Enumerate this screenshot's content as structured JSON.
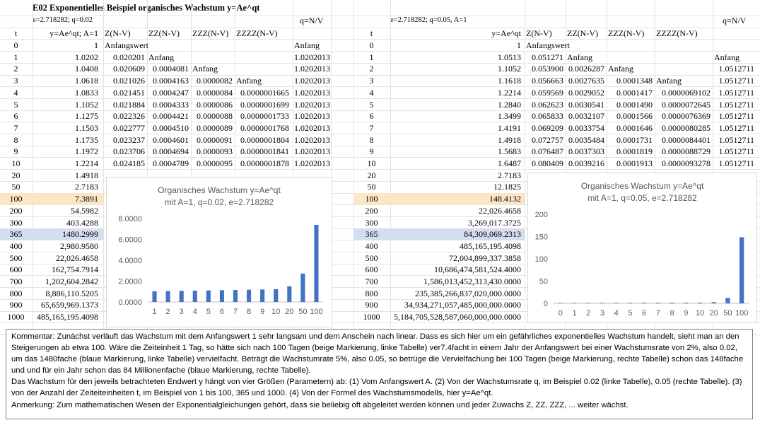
{
  "sheet": {
    "title": "E02 Exponentielles Beispiel organisches Wachstum y=Ae^qt",
    "left": {
      "params": "e=2.718282; q=0.02",
      "qnv": "q=N/V",
      "headers": [
        "t",
        "y=Ae^qt; A=1",
        "Z(N-V)",
        "ZZ(N-V)",
        "ZZZ(N-V)",
        "ZZZZ(N-V)",
        ""
      ],
      "rows": [
        [
          "0",
          "1",
          "Anfangswert",
          "",
          "",
          "",
          "Anfang"
        ],
        [
          "1",
          "1.0202",
          "0.020201",
          "Anfang",
          "",
          "",
          "1.0202013"
        ],
        [
          "2",
          "1.0408",
          "0.020609",
          "0.0004081",
          "Anfang",
          "",
          "1.0202013"
        ],
        [
          "3",
          "1.0618",
          "0.021026",
          "0.0004163",
          "0.0000082",
          "Anfang",
          "1.0202013"
        ],
        [
          "4",
          "1.0833",
          "0.021451",
          "0.0004247",
          "0.0000084",
          "0.0000001665",
          "1.0202013"
        ],
        [
          "5",
          "1.1052",
          "0.021884",
          "0.0004333",
          "0.0000086",
          "0.0000001699",
          "1.0202013"
        ],
        [
          "6",
          "1.1275",
          "0.022326",
          "0.0004421",
          "0.0000088",
          "0.0000001733",
          "1.0202013"
        ],
        [
          "7",
          "1.1503",
          "0.022777",
          "0.0004510",
          "0.0000089",
          "0.0000001768",
          "1.0202013"
        ],
        [
          "8",
          "1.1735",
          "0.023237",
          "0.0004601",
          "0.0000091",
          "0.0000001804",
          "1.0202013"
        ],
        [
          "9",
          "1.1972",
          "0.023706",
          "0.0004694",
          "0.0000093",
          "0.0000001841",
          "1.0202013"
        ],
        [
          "10",
          "1.2214",
          "0.024185",
          "0.0004789",
          "0.0000095",
          "0.0000001878",
          "1.0202013"
        ],
        [
          "20",
          "1.4918",
          "",
          "",
          "",
          "",
          ""
        ],
        [
          "50",
          "2.7183",
          "",
          "",
          "",
          "",
          ""
        ],
        [
          "100",
          "7.3891",
          "",
          "",
          "",
          "",
          ""
        ],
        [
          "200",
          "54.5982",
          "",
          "",
          "",
          "",
          ""
        ],
        [
          "300",
          "403.4288",
          "",
          "",
          "",
          "",
          ""
        ],
        [
          "365",
          "1480.2999",
          "",
          "",
          "",
          "",
          ""
        ],
        [
          "400",
          "2,980.9580",
          "",
          "",
          "",
          "",
          ""
        ],
        [
          "500",
          "22,026.4658",
          "",
          "",
          "",
          "",
          ""
        ],
        [
          "600",
          "162,754.7914",
          "",
          "",
          "",
          "",
          ""
        ],
        [
          "700",
          "1,202,604.2842",
          "",
          "",
          "",
          "",
          ""
        ],
        [
          "800",
          "8,886,110.5205",
          "",
          "",
          "",
          "",
          ""
        ],
        [
          "900",
          "65,659,969.1373",
          "",
          "",
          "",
          "",
          ""
        ],
        [
          "1000",
          "485,165,195.4098",
          "",
          "",
          "",
          "",
          ""
        ]
      ]
    },
    "right": {
      "params": "e=2.718282; q=0.05, A=1",
      "qnv": "q=N/V",
      "headers": [
        "t",
        "y=Ae^qt",
        "Z(N-V)",
        "ZZ(N-V)",
        "ZZZ(N-V)",
        "ZZZZ(N-V)",
        ""
      ],
      "rows": [
        [
          "0",
          "1",
          "Anfangswert",
          "",
          "",
          "",
          ""
        ],
        [
          "1",
          "1.0513",
          "0.051271",
          "Anfang",
          "",
          "",
          "Anfang"
        ],
        [
          "2",
          "1.1052",
          "0.053900",
          "0.0026287",
          "Anfang",
          "",
          "1.0512711"
        ],
        [
          "3",
          "1.1618",
          "0.056663",
          "0.0027635",
          "0.0001348",
          "Anfang",
          "1.0512711"
        ],
        [
          "4",
          "1.2214",
          "0.059569",
          "0.0029052",
          "0.0001417",
          "0.0000069102",
          "1.0512711"
        ],
        [
          "5",
          "1.2840",
          "0.062623",
          "0.0030541",
          "0.0001490",
          "0.0000072645",
          "1.0512711"
        ],
        [
          "6",
          "1.3499",
          "0.065833",
          "0.0032107",
          "0.0001566",
          "0.0000076369",
          "1.0512711"
        ],
        [
          "7",
          "1.4191",
          "0.069209",
          "0.0033754",
          "0.0001646",
          "0.0000080285",
          "1.0512711"
        ],
        [
          "8",
          "1.4918",
          "0.072757",
          "0.0035484",
          "0.0001731",
          "0.0000084401",
          "1.0512711"
        ],
        [
          "9",
          "1.5683",
          "0.076487",
          "0.0037303",
          "0.0001819",
          "0.0000088729",
          "1.0512711"
        ],
        [
          "10",
          "1.6487",
          "0.080409",
          "0.0039216",
          "0.0001913",
          "0.0000093278",
          "1.0512711"
        ],
        [
          "20",
          "2.7183",
          "",
          "",
          "",
          "",
          ""
        ],
        [
          "50",
          "12.1825",
          "",
          "",
          "",
          "",
          ""
        ],
        [
          "100",
          "148.4132",
          "",
          "",
          "",
          "",
          ""
        ],
        [
          "200",
          "22,026.4658",
          "",
          "",
          "",
          "",
          ""
        ],
        [
          "300",
          "3,269,017.3725",
          "",
          "",
          "",
          "",
          ""
        ],
        [
          "365",
          "84,309,069.2313",
          "",
          "",
          "",
          "",
          ""
        ],
        [
          "400",
          "485,165,195.4098",
          "",
          "",
          "",
          "",
          ""
        ],
        [
          "500",
          "72,004,899,337.3858",
          "",
          "",
          "",
          "",
          ""
        ],
        [
          "600",
          "10,686,474,581,524.4000",
          "",
          "",
          "",
          "",
          ""
        ],
        [
          "700",
          "1,586,013,452,313,430.0000",
          "",
          "",
          "",
          "",
          ""
        ],
        [
          "800",
          "235,385,266,837,020,000.0000",
          "",
          "",
          "",
          "",
          ""
        ],
        [
          "900",
          "34,934,271,057,485,000,000.0000",
          "",
          "",
          "",
          "",
          ""
        ],
        [
          "1000",
          "5,184,705,528,587,060,000,000.0000",
          "",
          "",
          "",
          "",
          ""
        ]
      ]
    },
    "highlight": {
      "beige": "#fbe7c6",
      "blue": "#d5deef",
      "bar": "#4472c4"
    }
  },
  "chart_data": [
    {
      "type": "bar",
      "title": "Organisches Wachstum y=Ae^qt",
      "subtitle": "mit A=1, q=0.02, e=2.718282",
      "categories": [
        "1",
        "2",
        "3",
        "4",
        "5",
        "6",
        "7",
        "8",
        "9",
        "10",
        "20",
        "50",
        "100"
      ],
      "values": [
        1.0202,
        1.0408,
        1.0618,
        1.0833,
        1.1052,
        1.1275,
        1.1503,
        1.1735,
        1.1972,
        1.2214,
        1.4918,
        2.7183,
        7.3891
      ],
      "yticks": [
        "0.0000",
        "2.0000",
        "4.0000",
        "6.0000",
        "8.0000"
      ],
      "ylim": [
        0,
        8
      ],
      "grid": false
    },
    {
      "type": "bar",
      "title": "Organisches Wachstum y=Ae^qt",
      "subtitle": "mit A=1, q=0.05, e=2.718282",
      "categories": [
        "0",
        "1",
        "2",
        "3",
        "4",
        "5",
        "6",
        "7",
        "8",
        "9",
        "10",
        "20",
        "50",
        "100"
      ],
      "values": [
        1,
        1.0513,
        1.1052,
        1.1618,
        1.2214,
        1.284,
        1.3499,
        1.4191,
        1.4918,
        1.5683,
        1.6487,
        2.7183,
        12.1825,
        148.4132
      ],
      "yticks": [
        "0",
        "50",
        "100",
        "150",
        "200"
      ],
      "ylim": [
        0,
        200
      ],
      "grid": false
    }
  ],
  "comment": [
    "Kommentar: Zunächst verläuft das Wachstum mit dem Anfangswert 1 sehr langsam und dem Anschein nach linear. Dass es sich hier um ein gefährliches exponentielles Wachstum handelt, sieht man an den Steigerungen ab etwa 100. Wäre die Zeiteinheit 1 Tag, so hätte sich nach 100 Tagen (beige Markierung, linke Tabelle)  ver7.4facht in einem Jahr der Anfangswert bei einer Wachstumsrate von 2%, also 0.02, um das 1480fache (blaue Markierung, linke Tabelle) vervielfacht. Beträgt die Wachstumrate 5%, also 0.05, so betrüge die Vervielfachung bei 100 Tagen (beige Markierung, rechte Tabelle) schon das 148fache und und für ein Jahr schon das 84 Millionenfache (blaue Markierung, rechte Tabelle).",
    "Das Wachstum für den jeweils betrachteten Endwert y hängt von vier Größen (Parametern) ab: (1) Vom  Anfangswert A. (2) Von der Wachstumsrate q, im Beispiel 0.02 (linke Tabelle), 0.05 (rechte Tabelle). (3) von der Anzahl der Zeiteiteinheiten t, im Beispiel von 1 bis 100, 365 und 1000. (4) Von der Formel des Wachstumsmodells, hier y=Ae^qt.",
    "Anmerkung: Zum mathematischen Wesen der Exponentialgleichungen gehört, dass sie beliebig oft abgeleitet werden können und jeder Zuwachs Z, ZZ, ZZZ, ... weiter wächst."
  ]
}
